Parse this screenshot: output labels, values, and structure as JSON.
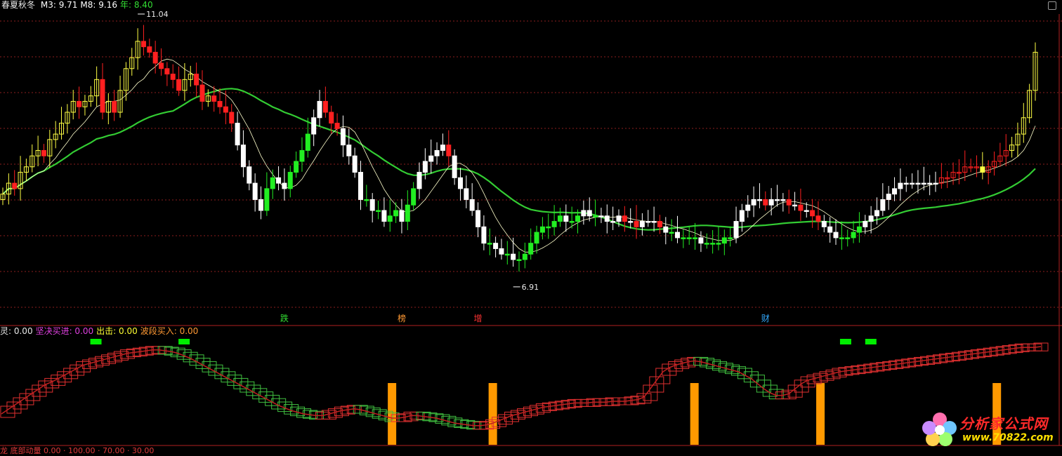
{
  "header": {
    "title": "春夏秋冬",
    "items": [
      {
        "label": "M3: 9.71",
        "color": "#ffffff"
      },
      {
        "label": "M8: 9.16",
        "color": "#ffffff"
      },
      {
        "label": "年: 8.40",
        "color": "#33dd33"
      }
    ]
  },
  "sub_header": {
    "items": [
      {
        "label": "灵: 0.00",
        "color": "#e8e8e8"
      },
      {
        "label": "坚决买进: 0.00",
        "color": "#e040e0"
      },
      {
        "label": "出击: 0.00",
        "color": "#ffff33"
      },
      {
        "label": "波段买入: 0.00",
        "color": "#ff9933"
      }
    ]
  },
  "bottom_header": "龙 底部动量 0.00 · 100.00 · 70.00 · 30.00",
  "watermark": {
    "name": "分析家公式网",
    "url": "www.70822.com"
  },
  "chart_data": [
    {
      "type": "candlestick",
      "title": "春夏秋冬",
      "price_range": [
        6.0,
        11.4
      ],
      "grid": true,
      "annotations": [
        {
          "text": "11.04",
          "kind": "high"
        },
        {
          "text": "6.91",
          "kind": "low"
        }
      ],
      "markers": [
        {
          "label": "跌",
          "color": "#33dd33",
          "index": 48
        },
        {
          "label": "榜",
          "color": "#ff9933",
          "index": 68
        },
        {
          "label": "增",
          "color": "#ff3333",
          "index": 81
        },
        {
          "label": "财",
          "color": "#33aaff",
          "index": 130
        }
      ],
      "series": [
        {
          "name": "M3",
          "color": "#ffffff"
        },
        {
          "name": "M8",
          "color": "#ffffcc"
        },
        {
          "name": "年",
          "color": "#33cc33"
        }
      ],
      "candle_colors": {
        "red": "#ff2020",
        "yellow": "#ffff44",
        "white": "#ffffff",
        "green": "#22ee22"
      },
      "closes": [
        8.1,
        8.3,
        8.2,
        8.5,
        8.6,
        8.8,
        8.9,
        8.8,
        9.1,
        9.2,
        9.4,
        9.6,
        9.8,
        9.7,
        9.8,
        9.9,
        10.2,
        9.6,
        9.8,
        9.6,
        10.0,
        10.4,
        10.6,
        10.9,
        10.8,
        10.7,
        10.5,
        10.4,
        10.3,
        10.2,
        10.0,
        10.2,
        10.3,
        10.1,
        9.8,
        9.9,
        9.8,
        9.7,
        9.6,
        9.4,
        9.0,
        8.6,
        8.3,
        8.0,
        7.8,
        8.2,
        8.4,
        8.3,
        8.2,
        8.5,
        8.7,
        8.9,
        9.2,
        9.5,
        9.8,
        9.6,
        9.4,
        9.3,
        9.0,
        8.8,
        8.5,
        8.0,
        8.0,
        7.8,
        7.8,
        7.6,
        7.7,
        7.8,
        7.6,
        7.9,
        8.2,
        8.5,
        8.7,
        8.8,
        8.9,
        9.0,
        8.8,
        8.4,
        8.2,
        8.0,
        7.8,
        7.5,
        7.2,
        7.2,
        7.1,
        7.0,
        7.0,
        6.9,
        6.9,
        7.0,
        7.2,
        7.4,
        7.5,
        7.5,
        7.6,
        7.7,
        7.6,
        7.6,
        7.7,
        7.8,
        7.7,
        7.7,
        7.7,
        7.6,
        7.6,
        7.7,
        7.6,
        7.6,
        7.5,
        7.6,
        7.6,
        7.6,
        7.5,
        7.4,
        7.4,
        7.3,
        7.3,
        7.3,
        7.3,
        7.2,
        7.2,
        7.2,
        7.2,
        7.3,
        7.3,
        7.6,
        7.8,
        7.9,
        8.0,
        8.0,
        7.9,
        8.0,
        8.0,
        8.0,
        7.9,
        7.9,
        7.8,
        7.8,
        7.7,
        7.6,
        7.5,
        7.4,
        7.3,
        7.3,
        7.3,
        7.4,
        7.5,
        7.6,
        7.7,
        7.8,
        8.0,
        8.1,
        8.2,
        8.3,
        8.3,
        8.3,
        8.3,
        8.3,
        8.3,
        8.3,
        8.4,
        8.4,
        8.5,
        8.5,
        8.6,
        8.6,
        8.6,
        8.5,
        8.6,
        8.7,
        8.8,
        8.9,
        9.0,
        9.2,
        9.5,
        10.0,
        10.7
      ]
    },
    {
      "type": "line",
      "title": "",
      "range": [
        0,
        100
      ],
      "levels": [
        100,
        70,
        30
      ],
      "bar_color": "#ff9900",
      "flag_color": "#00ee00",
      "bar_positions": [
        62,
        78,
        110,
        130,
        158
      ],
      "flag_positions": [
        15,
        29,
        134,
        138
      ],
      "values": [
        20,
        25,
        30,
        35,
        40,
        45,
        50,
        55,
        58,
        62,
        66,
        70,
        74,
        78,
        80,
        82,
        84,
        86,
        88,
        90,
        92,
        93,
        94,
        95,
        96,
        96,
        95,
        94,
        92,
        89,
        86,
        82,
        78,
        74,
        70,
        66,
        62,
        58,
        54,
        50,
        46,
        42,
        38,
        34,
        30,
        27,
        24,
        22,
        20,
        19,
        18,
        18,
        20,
        22,
        24,
        25,
        26,
        25,
        23,
        21,
        19,
        17,
        15,
        15,
        16,
        18,
        18,
        17,
        16,
        15,
        13,
        11,
        9,
        8,
        7,
        6,
        6,
        7,
        9,
        12,
        15,
        18,
        20,
        22,
        24,
        26,
        28,
        29,
        30,
        31,
        32,
        33,
        33,
        33,
        34,
        34,
        34,
        35,
        35,
        35,
        36,
        37,
        40,
        50,
        60,
        70,
        75,
        78,
        80,
        82,
        83,
        82,
        80,
        78,
        76,
        74,
        72,
        70,
        66,
        62,
        56,
        50,
        45,
        42,
        42,
        44,
        50,
        56,
        60,
        62,
        64,
        66,
        68,
        70,
        71,
        72,
        73,
        74,
        75,
        76,
        77,
        78,
        79,
        80,
        81,
        82,
        83,
        84,
        85,
        86,
        87,
        88,
        89,
        90,
        91,
        92,
        93,
        94,
        95,
        96,
        97,
        98,
        99,
        99,
        99,
        100
      ]
    }
  ]
}
